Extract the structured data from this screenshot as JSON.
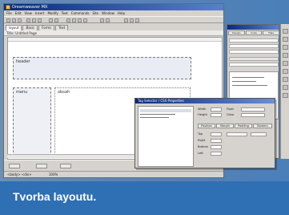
{
  "ide": {
    "title": "Dreamweaver MX",
    "menu": [
      "File",
      "Edit",
      "View",
      "Insert",
      "Modify",
      "Text",
      "Commands",
      "Site",
      "Window",
      "Help"
    ],
    "doc_tabs": [
      "layout",
      "Basic",
      "Forms",
      "Text"
    ],
    "subbar_text": "Title: Untitled Page",
    "boxes": {
      "header": "header",
      "menu": "menu",
      "obsah": "obsah"
    },
    "status_text": "100%",
    "statusbar_text": "<body> <div>"
  },
  "dialog": {
    "title": "Tag Selector / CSS Properties",
    "labels": [
      "Width",
      "Height",
      "Float",
      "Clear",
      "Top",
      "Right",
      "Bottom",
      "Left"
    ],
    "tabs": [
      "Position",
      "Margin",
      "Padding",
      "Borders"
    ]
  },
  "right_panel": {
    "tabs": [
      "Design",
      "Code",
      "Files"
    ]
  },
  "caption": {
    "text": "Tvorba layoutu."
  }
}
